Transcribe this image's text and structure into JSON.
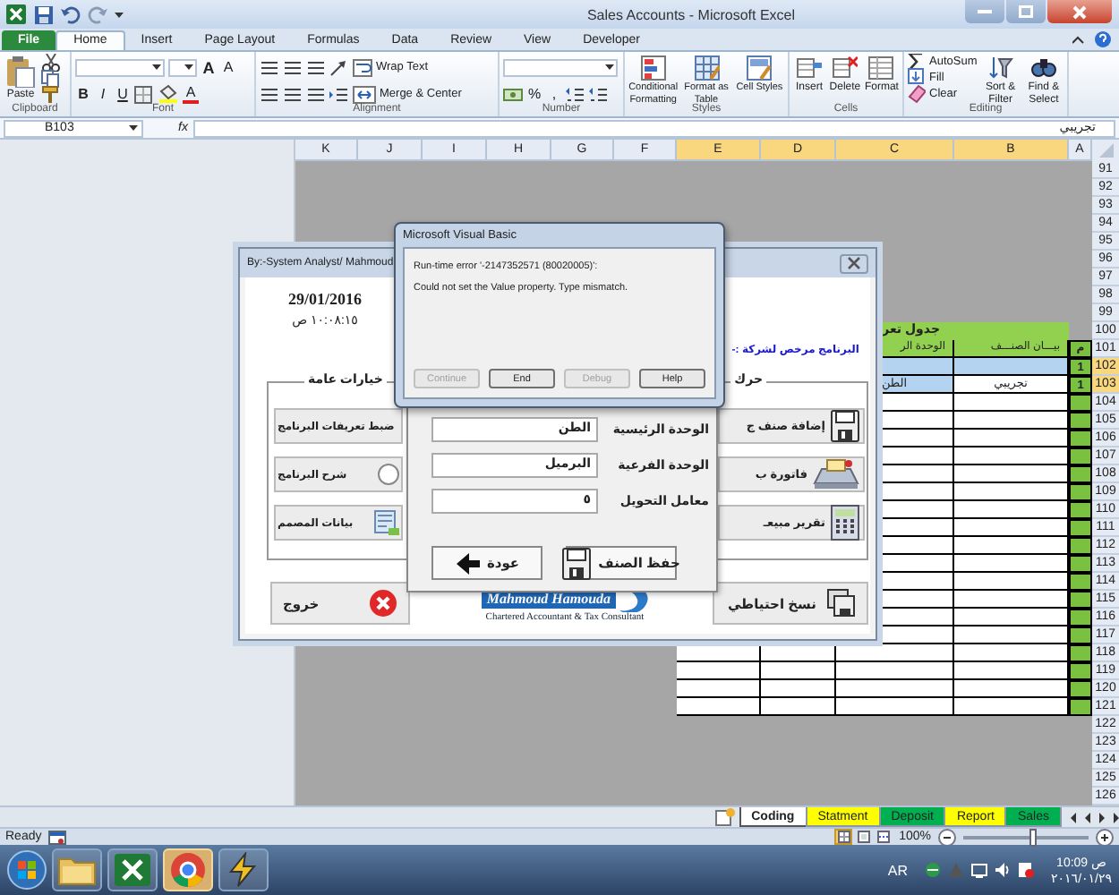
{
  "title_bar": {
    "title": "Sales Accounts - Microsoft Excel"
  },
  "ribbon_tabs": [
    {
      "label": "File",
      "kind": "file",
      "selected": false
    },
    {
      "label": "Home",
      "kind": "tab",
      "selected": true
    },
    {
      "label": "Insert",
      "kind": "tab",
      "selected": false
    },
    {
      "label": "Page Layout",
      "kind": "tab",
      "selected": false
    },
    {
      "label": "Formulas",
      "kind": "tab",
      "selected": false
    },
    {
      "label": "Data",
      "kind": "tab",
      "selected": false
    },
    {
      "label": "Review",
      "kind": "tab",
      "selected": false
    },
    {
      "label": "View",
      "kind": "tab",
      "selected": false
    },
    {
      "label": "Developer",
      "kind": "tab",
      "selected": false
    }
  ],
  "ribbon": {
    "groups": [
      {
        "kind": "clipboard",
        "label": "Clipboard",
        "buttons": [
          "Paste"
        ]
      },
      {
        "kind": "font",
        "label": "Font",
        "buttons": [
          "B",
          "I",
          "U"
        ],
        "letters": [
          "A",
          "A",
          "A"
        ]
      },
      {
        "kind": "alignment",
        "label": "Alignment",
        "buttons": [
          "Wrap Text",
          "Merge & Center"
        ]
      },
      {
        "kind": "number",
        "label": "Number",
        "buttons": [
          "%",
          ","
        ]
      },
      {
        "kind": "styles",
        "label": "Styles",
        "buttons": [
          "Conditional Formatting",
          "Format as Table",
          "Cell Styles"
        ]
      },
      {
        "kind": "cells",
        "label": "Cells",
        "buttons": [
          "Insert",
          "Delete",
          "Format"
        ]
      },
      {
        "kind": "editing",
        "label": "Editing",
        "small": [
          "AutoSum",
          "Fill",
          "Clear"
        ],
        "buttons": [
          "Sort & Filter",
          "Find & Select"
        ]
      }
    ]
  },
  "formula_bar": {
    "name_box": "B103",
    "function_label": "fx",
    "value": "تجريبي"
  },
  "sheet": {
    "columns": [
      {
        "label": "K",
        "selected": false
      },
      {
        "label": "J",
        "selected": false
      },
      {
        "label": "I",
        "selected": false
      },
      {
        "label": "H",
        "selected": false
      },
      {
        "label": "G",
        "selected": false
      },
      {
        "label": "F",
        "selected": false
      },
      {
        "label": "E",
        "selected": true
      },
      {
        "label": "D",
        "selected": true
      },
      {
        "label": "C",
        "selected": true
      },
      {
        "label": "B",
        "selected": true
      },
      {
        "label": "A",
        "selected": false
      }
    ],
    "rows": [
      {
        "number": "91",
        "selected": false,
        "kind": "empty"
      },
      {
        "number": "92",
        "selected": false,
        "kind": "empty"
      },
      {
        "number": "93",
        "selected": false,
        "kind": "empty"
      },
      {
        "number": "94",
        "selected": false,
        "kind": "empty"
      },
      {
        "number": "95",
        "selected": false,
        "kind": "empty"
      },
      {
        "number": "96",
        "selected": false,
        "kind": "empty"
      },
      {
        "number": "97",
        "selected": false,
        "kind": "empty"
      },
      {
        "number": "98",
        "selected": false,
        "kind": "empty"
      },
      {
        "number": "99",
        "selected": false,
        "kind": "empty"
      },
      {
        "number": "100",
        "selected": false,
        "kind": "title",
        "text": "جدول تعر"
      },
      {
        "number": "101",
        "selected": false,
        "kind": "header",
        "cells": [
          "م",
          "بيـــان الصنـــف",
          "الوحدة الر"
        ]
      },
      {
        "number": "102",
        "selected": true,
        "kind": "entry",
        "cells": [
          {
            "text": "1"
          },
          {
            "shaded": true
          },
          {
            "shaded": true
          }
        ]
      },
      {
        "number": "103",
        "selected": true,
        "kind": "entry",
        "cells": [
          {
            "text": "1"
          },
          {
            "shaded": false,
            "text": "تجريبي"
          },
          {
            "shaded": true,
            "text": "الطن"
          }
        ]
      },
      {
        "number": "104",
        "selected": false,
        "kind": "blank"
      },
      {
        "number": "105",
        "selected": false,
        "kind": "blank"
      },
      {
        "number": "106",
        "selected": false,
        "kind": "blank"
      },
      {
        "number": "107",
        "selected": false,
        "kind": "blank"
      },
      {
        "number": "108",
        "selected": false,
        "kind": "blank"
      },
      {
        "number": "109",
        "selected": false,
        "kind": "blank"
      },
      {
        "number": "110",
        "selected": false,
        "kind": "blank"
      },
      {
        "number": "111",
        "selected": false,
        "kind": "blank"
      },
      {
        "number": "112",
        "selected": false,
        "kind": "blank"
      },
      {
        "number": "113",
        "selected": false,
        "kind": "blank"
      },
      {
        "number": "114",
        "selected": false,
        "kind": "blank"
      },
      {
        "number": "115",
        "selected": false,
        "kind": "blank"
      },
      {
        "number": "116",
        "selected": false,
        "kind": "blank"
      },
      {
        "number": "117",
        "selected": false,
        "kind": "blank"
      },
      {
        "number": "118",
        "selected": false,
        "kind": "blank"
      },
      {
        "number": "119",
        "selected": false,
        "kind": "blank"
      },
      {
        "number": "120",
        "selected": false,
        "kind": "blank"
      },
      {
        "number": "121",
        "selected": false,
        "kind": "blank"
      },
      {
        "number": "122",
        "selected": false,
        "kind": "empty"
      },
      {
        "number": "123",
        "selected": false,
        "kind": "empty"
      },
      {
        "number": "124",
        "selected": false,
        "kind": "empty"
      },
      {
        "number": "125",
        "selected": false,
        "kind": "empty"
      },
      {
        "number": "126",
        "selected": false,
        "kind": "empty"
      }
    ]
  },
  "sheet_tabs": [
    {
      "label": "Coding",
      "selected": true,
      "color": "#ffffff"
    },
    {
      "label": "Statment",
      "selected": false,
      "color": "#ffff00"
    },
    {
      "label": "Deposit",
      "selected": false,
      "color": "#00b050"
    },
    {
      "label": "Report",
      "selected": false,
      "color": "#ffff00"
    },
    {
      "label": "Sales",
      "selected": false,
      "color": "#00b050"
    }
  ],
  "status_bar": {
    "status": "Ready",
    "views": [
      {
        "kind": "normal",
        "selected": true
      },
      {
        "kind": "layout",
        "selected": false
      },
      {
        "kind": "break",
        "selected": false
      }
    ],
    "zoom": "100%",
    "zoom_slider": {
      "level": 0.55
    }
  },
  "user_form": {
    "title": "By:-System Analyst/ Mahmoud",
    "date": "29/01/2016",
    "time": "١٠:٠٨:١٥ ص",
    "license_text": "البرنامج مرخص لشركة :-",
    "general_frame": {
      "caption": "خيارات عامة",
      "buttons": [
        {
          "label": "ضبط تعريفات البرنامج",
          "kind": "plain"
        },
        {
          "label": "شرح البرنامج",
          "kind": "help"
        },
        {
          "label": "بيانات المصمم",
          "kind": "designer"
        }
      ]
    },
    "items_frame": {
      "caption": "حرك",
      "buttons": [
        {
          "label": "إضافة صنف ج",
          "kind": "add"
        },
        {
          "label": "فاتورة ب",
          "kind": "invoice"
        },
        {
          "label": "تقرير مبيعـ",
          "kind": "report"
        }
      ]
    },
    "exit_button": "خروج",
    "logo": {
      "name": "Mahmoud Hamouda",
      "tagline": "Chartered Accountant & Tax Consultant"
    },
    "backup_button": "نسخ احتياطي",
    "unit_panel": {
      "fields": [
        {
          "label": "الوحدة الرئيسية",
          "value": "الطن"
        },
        {
          "label": "الوحدة الفرعية",
          "value": "البرميل"
        },
        {
          "label": "معامل التحويل",
          "value": "٥"
        }
      ],
      "save_button": "حفظ الصنف",
      "back_button": "عودة"
    }
  },
  "error_dialog": {
    "title": "Microsoft Visual Basic",
    "message": [
      "Run-time error '-2147352571 (80020005)':",
      "Could not set the Value property. Type mismatch."
    ],
    "buttons": [
      {
        "label": "Continue",
        "disabled": true
      },
      {
        "label": "End",
        "disabled": false
      },
      {
        "label": "Debug",
        "disabled": true
      },
      {
        "label": "Help",
        "disabled": false
      }
    ]
  },
  "taskbar": {
    "apps": [
      {
        "kind": "folder",
        "selected": false
      },
      {
        "kind": "excel",
        "selected": false
      },
      {
        "kind": "chrome",
        "selected": true
      },
      {
        "kind": "lightning",
        "selected": false
      }
    ],
    "language": "AR",
    "time": "10:09 ص",
    "date": "٢٠١٦/٠١/٢٩"
  }
}
